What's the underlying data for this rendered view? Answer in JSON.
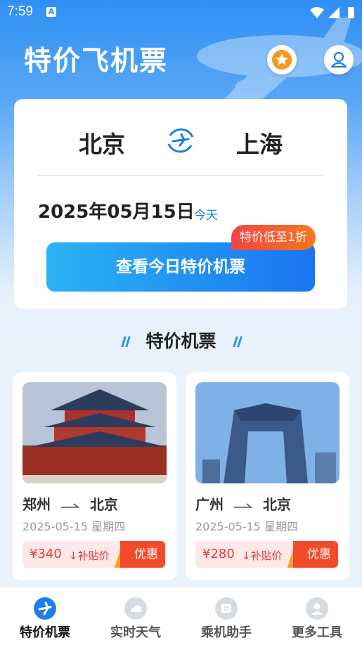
{
  "status_bar": {
    "time": "7:59"
  },
  "header": {
    "title": "特价飞机票"
  },
  "search_card": {
    "from_city": "北京",
    "to_city": "上海",
    "date": "2025年05月15日",
    "date_hint": "今天",
    "search_button": "查看今日特价机票",
    "discount_tag": "特价低至1折"
  },
  "section": {
    "title": "特价机票"
  },
  "deals": [
    {
      "from": "郑州",
      "to": "北京",
      "date": "2025-05-15 星期四",
      "price": "¥340",
      "subsidy": "补贴价",
      "promo": "优惠"
    },
    {
      "from": "广州",
      "to": "北京",
      "date": "2025-05-15 星期四",
      "price": "¥280",
      "subsidy": "补贴价",
      "promo": "优惠"
    }
  ],
  "bottom_nav": [
    {
      "label": "特价机票",
      "icon": "plane-icon",
      "active": true
    },
    {
      "label": "实时天气",
      "icon": "weather-icon",
      "active": false
    },
    {
      "label": "乘机助手",
      "icon": "ticket-icon",
      "active": false
    },
    {
      "label": "更多工具",
      "icon": "profile-icon",
      "active": false
    }
  ],
  "colors": {
    "primary": "#1a75f1",
    "accent_red": "#e83a3a",
    "star": "#f79a1a"
  }
}
